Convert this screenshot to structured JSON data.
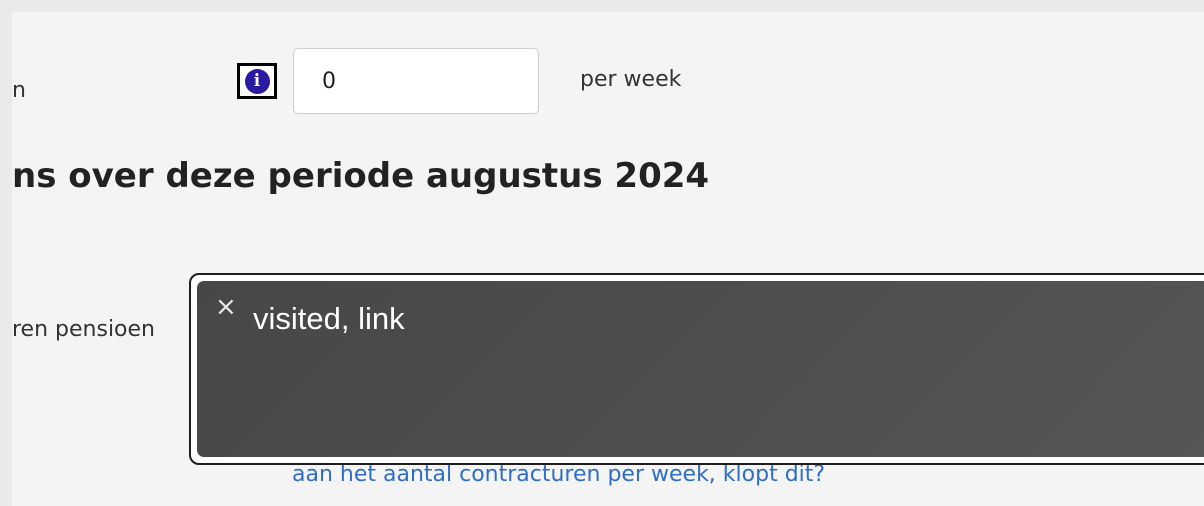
{
  "form": {
    "hours_label": "n",
    "hours_value": "0",
    "unit": "per week",
    "section_heading": "ns over deze periode augustus 2024",
    "pension_label": "ren pensioen",
    "warning_link": "aan het aantal contracturen per week, klopt dit?",
    "info_glyph": "i"
  },
  "tooltip": {
    "close_glyph": "×",
    "text": "visited, link"
  },
  "icons": {
    "info": "info-icon",
    "close": "close-icon"
  },
  "colors": {
    "info_icon_bg": "#2a1aa0",
    "link": "#2f6ec6",
    "tooltip_bg": "#4e4e4e",
    "page_bg": "#f4f4f4"
  }
}
